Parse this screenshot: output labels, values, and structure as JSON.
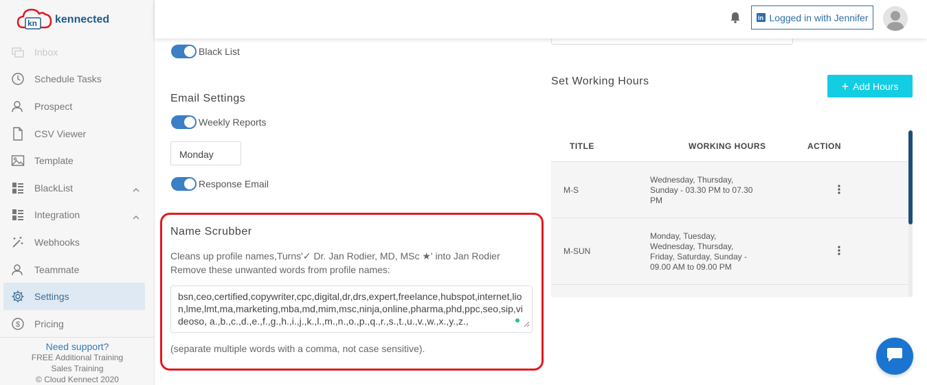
{
  "brand": {
    "logo_mark": "kn",
    "name": "kennected"
  },
  "sidebar": {
    "items": [
      {
        "label": "Inbox",
        "icon": "inbox-icon"
      },
      {
        "label": "Schedule Tasks",
        "icon": "clock-icon"
      },
      {
        "label": "Prospect",
        "icon": "user-icon"
      },
      {
        "label": "CSV Viewer",
        "icon": "file-icon"
      },
      {
        "label": "Template",
        "icon": "image-icon"
      },
      {
        "label": "BlackList",
        "icon": "list-icon"
      },
      {
        "label": "Integration",
        "icon": "list-icon"
      },
      {
        "label": "Webhooks",
        "icon": "magic-wand-icon"
      },
      {
        "label": "Teammate",
        "icon": "user-icon"
      },
      {
        "label": "Settings",
        "icon": "gear-icon"
      },
      {
        "label": "Pricing",
        "icon": "dollar-icon"
      }
    ],
    "support": {
      "need_support": "Need support?",
      "training": "FREE Additional Training",
      "sales": "Sales Training",
      "copyright": "© Cloud Kennect 2020"
    }
  },
  "header": {
    "logged_in": "Logged in with Jennifer",
    "linkedin_badge": "in"
  },
  "settings": {
    "black_list": "Black List",
    "email_settings_title": "Email Settings",
    "weekly_reports": "Weekly Reports",
    "weekly_day": "Monday",
    "response_email": "Response Email"
  },
  "name_scrubber": {
    "title": "Name Scrubber",
    "description": "Cleans up profile names,Turns'✓ Dr. Jan Rodier, MD, MSc ★' into Jan Rodier Remove these unwanted words from profile names:",
    "words": "bsn,ceo,certified,copywriter,cpc,digital,dr,drs,expert,freelance,hubspot,internet,lion,lme,lmt,ma,marketing,mba,md,mim,msc,ninja,online,pharma,phd,ppc,seo,sip,videoso, a.,b.,c.,d.,e.,f.,g.,h.,i.,j.,k.,l.,m.,n.,o.,p.,q.,r.,s.,t.,u.,v.,w.,x.,y.,z.,",
    "note": "(separate multiple words with a comma, not case sensitive)."
  },
  "working_hours": {
    "title": "Set Working Hours",
    "add_button": "Add Hours",
    "columns": [
      "TITLE",
      "WORKING HOURS",
      "ACTION"
    ],
    "rows": [
      {
        "title": "M-S",
        "hours": "Wednesday, Thursday, Sunday - 03.30 PM to 07.30 PM"
      },
      {
        "title": "M-SUN",
        "hours": "Monday, Tuesday, Wednesday, Thursday, Friday, Saturday, Sunday - 09.00 AM to 09.00 PM"
      }
    ]
  },
  "colors": {
    "accent": "#3b7fc4",
    "add_button": "#13cde3",
    "highlight": "#e3191f",
    "chat": "#1b75d0"
  }
}
